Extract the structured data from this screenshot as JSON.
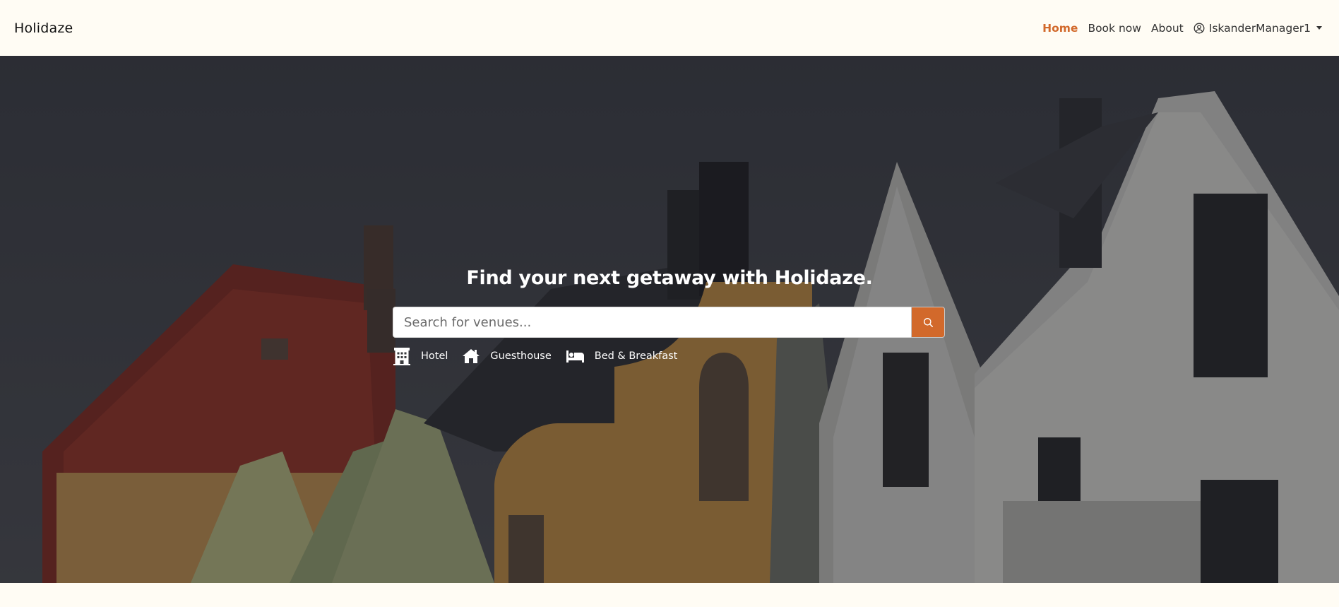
{
  "header": {
    "brand": "Holidaze",
    "nav": [
      {
        "label": "Home",
        "active": true
      },
      {
        "label": "Book now",
        "active": false
      },
      {
        "label": "About",
        "active": false
      }
    ],
    "user": {
      "name": "IskanderManager1",
      "icon": "user-circle-icon"
    }
  },
  "hero": {
    "title": "Find your next getaway with Holidaze.",
    "search": {
      "placeholder": "Search for venues...",
      "value": "",
      "button_icon": "search-icon"
    },
    "categories": [
      {
        "label": "Hotel",
        "icon": "building-icon"
      },
      {
        "label": "Guesthouse",
        "icon": "house-icon"
      },
      {
        "label": "Bed & Breakfast",
        "icon": "bed-icon"
      }
    ]
  },
  "colors": {
    "accent": "#d2692b",
    "background": "#fffcf4"
  }
}
